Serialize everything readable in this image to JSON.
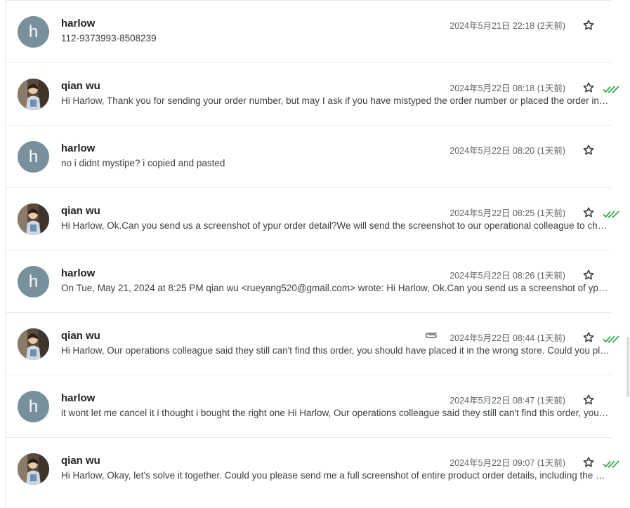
{
  "colors": {
    "avatar_bg": "#78909c",
    "check_green": "#34a853",
    "divider": "#e8eaed"
  },
  "messages": [
    {
      "sender": "harlow",
      "avatar_letter": "h",
      "date": "2024年5月21日 22:18 (2天前)",
      "snippet": "112-9373993-8508239",
      "has_attachment": false,
      "read_receipt": false
    },
    {
      "sender": "qian wu",
      "avatar_letter": "",
      "date": "2024年5月22日 08:18 (1天前)",
      "snippet": "Hi Harlow, Thank you for sending your order number, but may I ask if you have mistyped the order number or placed the order in the wrong store?",
      "has_attachment": false,
      "read_receipt": true
    },
    {
      "sender": "harlow",
      "avatar_letter": "h",
      "date": "2024年5月22日 08:20 (1天前)",
      "snippet": "no i didnt mystipe? i copied and pasted",
      "has_attachment": false,
      "read_receipt": false
    },
    {
      "sender": "qian wu",
      "avatar_letter": "",
      "date": "2024年5月22日 08:25 (1天前)",
      "snippet": "Hi Harlow, Ok.Can you send us a screenshot of ypur order detail?We will send the screenshot to our operational colleague to check.",
      "has_attachment": false,
      "read_receipt": true
    },
    {
      "sender": "harlow",
      "avatar_letter": "h",
      "date": "2024年5月22日 08:26 (1天前)",
      "snippet": "On Tue, May 21, 2024 at 8:25 PM qian wu <rueyang520@gmail.com> wrote: Hi Harlow, Ok.Can you send us a screenshot of ypur order detail?",
      "has_attachment": false,
      "read_receipt": false
    },
    {
      "sender": "qian wu",
      "avatar_letter": "",
      "date": "2024年5月22日 08:44 (1天前)",
      "snippet": "Hi Harlow, Our operations colleague said they still can't find this order, you should have placed it in the wrong store. Could you please check again?",
      "has_attachment": true,
      "read_receipt": true
    },
    {
      "sender": "harlow",
      "avatar_letter": "h",
      "date": "2024年5月22日 08:47 (1天前)",
      "snippet": "it wont let me cancel it i thought i bought the right one Hi Harlow, Our operations colleague said they still can't find this order, you should have placed it in the wrong store.",
      "has_attachment": false,
      "read_receipt": false
    },
    {
      "sender": "qian wu",
      "avatar_letter": "",
      "date": "2024年5月22日 09:07 (1天前)",
      "snippet": "Hi Harlow, Okay, let's solve it together. Could you please send me a full screenshot of entire product order details, including the store name?",
      "has_attachment": false,
      "read_receipt": true
    }
  ]
}
